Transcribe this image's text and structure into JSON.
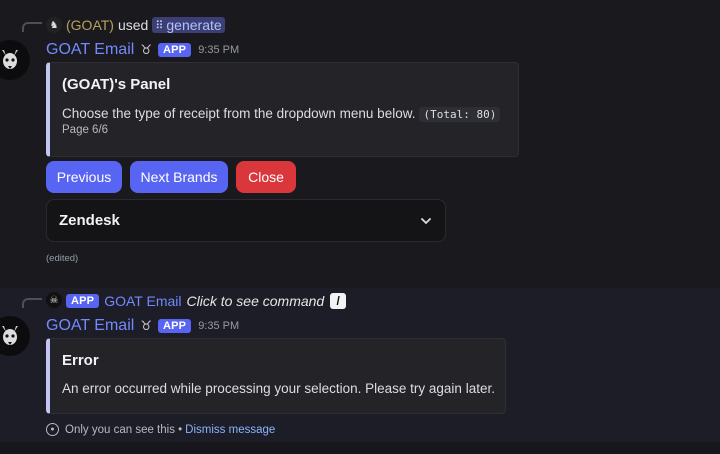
{
  "message1": {
    "reply": {
      "user": "(GOAT)",
      "used": "used",
      "command_icon": "apps-icon",
      "command": "generate"
    },
    "author": "GOAT Email",
    "badge": "APP",
    "time": "9:35 PM",
    "embed": {
      "title": "(GOAT)'s Panel",
      "description": "Choose the type of receipt from the dropdown menu below.",
      "total": "(Total: 80)",
      "footer": "Page 6/6",
      "accent": "#c3c6f5"
    },
    "buttons": {
      "previous": "Previous",
      "next": "Next Brands",
      "close": "Close"
    },
    "select": {
      "value": "Zendesk"
    },
    "edited": "(edited)"
  },
  "message2": {
    "reply": {
      "badge": "APP",
      "author": "GOAT Email",
      "click_text": "Click to see command"
    },
    "author": "GOAT Email",
    "badge": "APP",
    "time": "9:35 PM",
    "embed": {
      "title": "Error",
      "description": "An error occurred while processing your selection. Please try again later.",
      "accent": "#c3c6f5"
    },
    "ephemeral": {
      "text": "Only you can see this •",
      "dismiss": "Dismiss message"
    }
  },
  "colors": {
    "blurple": "#5865f2",
    "danger": "#da373c",
    "author": "#7289ff",
    "link": "#8ab4ff"
  }
}
